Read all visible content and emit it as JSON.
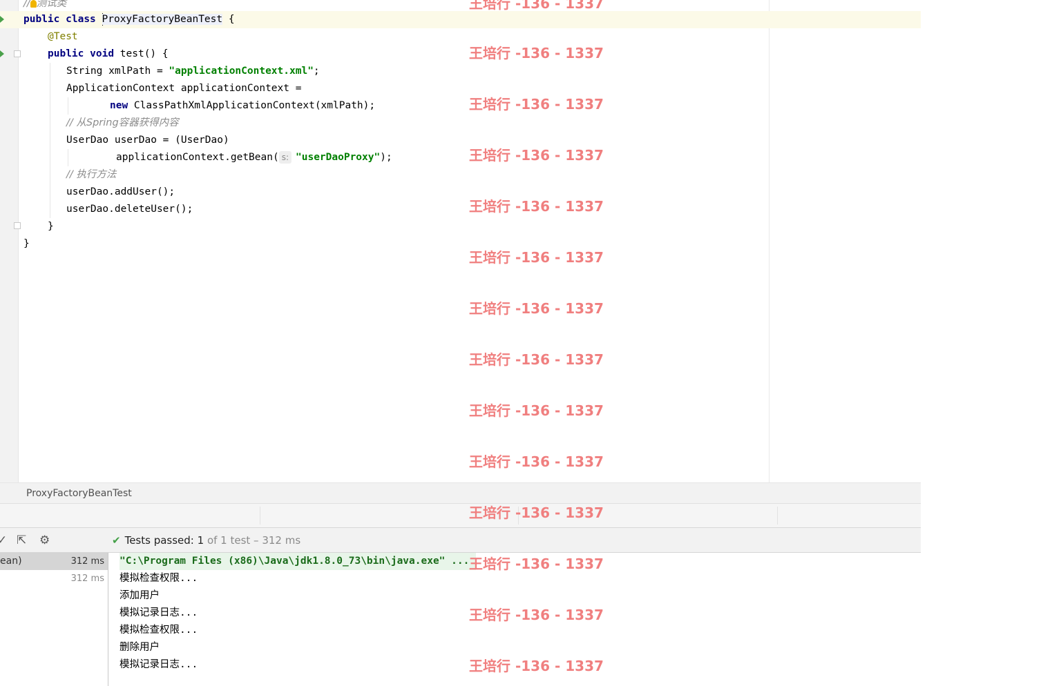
{
  "editor": {
    "lines": [
      {
        "parts": [
          {
            "t": "//",
            "c": "cmt"
          },
          {
            "t": "测试类",
            "c": "cmt"
          }
        ]
      },
      {
        "parts": [
          {
            "t": "public",
            "c": "kw"
          },
          {
            "t": " ",
            "c": ""
          },
          {
            "t": "class",
            "c": "kw"
          },
          {
            "t": " ",
            "c": ""
          },
          {
            "t": "ProxyFactoryBeanTest",
            "c": "hl"
          },
          {
            "t": " {",
            "c": ""
          }
        ]
      },
      {
        "parts": [
          {
            "t": "@Test",
            "c": "ann"
          }
        ]
      },
      {
        "parts": [
          {
            "t": "public",
            "c": "kw"
          },
          {
            "t": " ",
            "c": ""
          },
          {
            "t": "void",
            "c": "kw"
          },
          {
            "t": " test() {",
            "c": ""
          }
        ]
      },
      {
        "parts": [
          {
            "t": "String xmlPath = ",
            "c": ""
          },
          {
            "t": "\"applicationContext.xml\"",
            "c": "str"
          },
          {
            "t": ";",
            "c": ""
          }
        ]
      },
      {
        "parts": [
          {
            "t": "ApplicationContext applicationContext =",
            "c": ""
          }
        ]
      },
      {
        "parts": [
          {
            "t": "new",
            "c": "kw"
          },
          {
            "t": " ClassPathXmlApplicationContext(xmlPath);",
            "c": ""
          }
        ]
      },
      {
        "parts": [
          {
            "t": "// 从Spring容器获得内容",
            "c": "cmt"
          }
        ]
      },
      {
        "parts": [
          {
            "t": "UserDao userDao = (UserDao)",
            "c": ""
          }
        ]
      },
      {
        "parts": [
          {
            "t": "applicationContext.getBean(",
            "c": ""
          },
          {
            "t": "s:",
            "c": "hint"
          },
          {
            "t": "\"userDaoProxy\"",
            "c": "str"
          },
          {
            "t": ");",
            "c": ""
          }
        ]
      },
      {
        "parts": [
          {
            "t": "// 执行方法",
            "c": "cmt"
          }
        ]
      },
      {
        "parts": [
          {
            "t": "userDao.addUser();",
            "c": ""
          }
        ]
      },
      {
        "parts": [
          {
            "t": "userDao.deleteUser();",
            "c": ""
          }
        ]
      },
      {
        "parts": [
          {
            "t": "}",
            "c": ""
          }
        ]
      },
      {
        "parts": [
          {
            "t": "}",
            "c": ""
          }
        ]
      }
    ]
  },
  "watermark": "王培行 -136 - 1337",
  "breadcrumb": "ProxyFactoryBeanTest",
  "test_status": {
    "prefix": "Tests passed: ",
    "count": "1",
    "rest": " of 1 test – 312 ms"
  },
  "tree": [
    {
      "name": "ean)",
      "time": "312 ms"
    },
    {
      "name": "",
      "time": "312 ms"
    }
  ],
  "console": [
    "\"C:\\Program Files (x86)\\Java\\jdk1.8.0_73\\bin\\java.exe\" ...",
    "模拟检查权限...",
    "添加用户",
    "模拟记录日志...",
    "模拟检查权限...",
    "删除用户",
    "模拟记录日志..."
  ],
  "icons": {
    "check": "✔",
    "gear": "⚙",
    "export": "⇱",
    "collapse": "✓"
  }
}
